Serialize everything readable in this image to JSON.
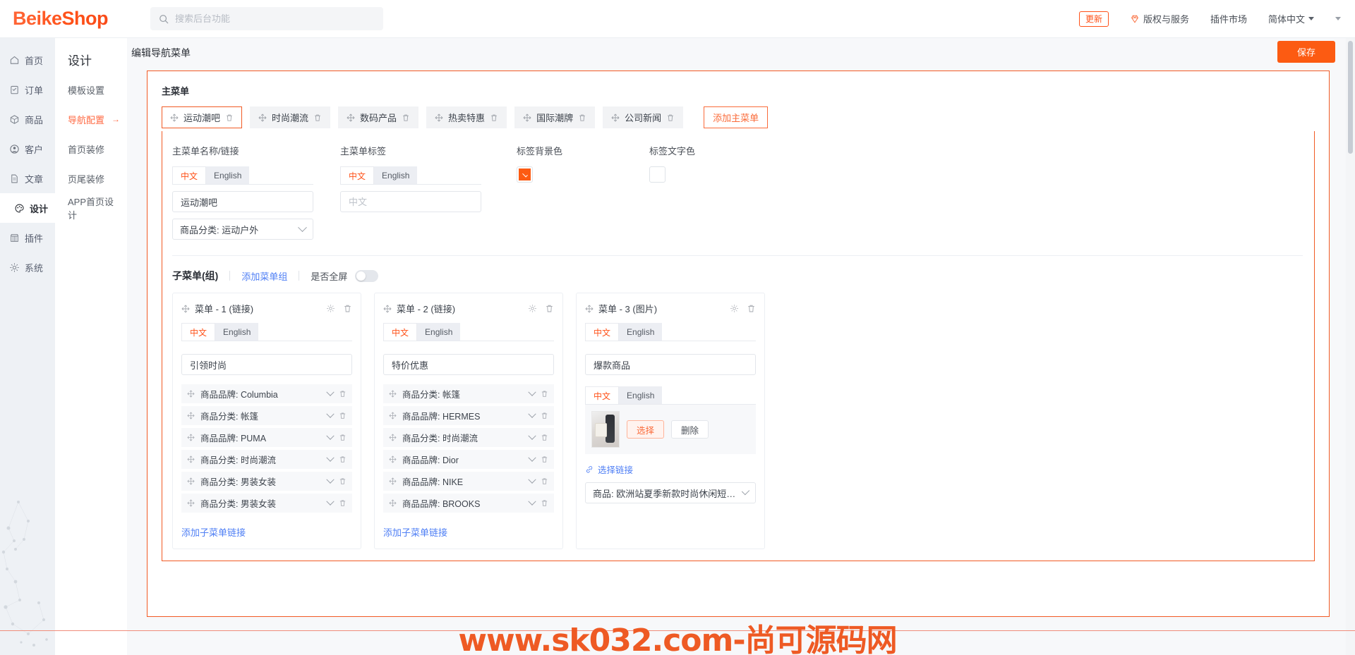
{
  "header": {
    "logo": "BeikeShop",
    "search_placeholder": "搜索后台功能",
    "search_value": "",
    "update_badge": "更新",
    "copyright": "版权与服务",
    "plugin_market": "插件市场",
    "language": "简体中文",
    "accent_color": "#ff5118"
  },
  "rail": {
    "items": [
      {
        "label": "首页",
        "icon": "home-icon"
      },
      {
        "label": "订单",
        "icon": "clipboard-icon"
      },
      {
        "label": "商品",
        "icon": "box-icon"
      },
      {
        "label": "客户",
        "icon": "user-icon"
      },
      {
        "label": "文章",
        "icon": "file-icon"
      },
      {
        "label": "设计",
        "icon": "palette-icon",
        "active": true
      },
      {
        "label": "插件",
        "icon": "shop-icon"
      },
      {
        "label": "系统",
        "icon": "gear-icon"
      }
    ]
  },
  "submenu": {
    "title": "设计",
    "items": [
      {
        "label": "模板设置"
      },
      {
        "label": "导航配置",
        "active": true,
        "arrow": "→"
      },
      {
        "label": "首页装修"
      },
      {
        "label": "页尾装修"
      },
      {
        "label": "APP首页设计"
      }
    ]
  },
  "page": {
    "title": "编辑导航菜单",
    "save_label": "保存"
  },
  "main_menu": {
    "section_label": "主菜单",
    "tabs": [
      {
        "label": "运动潮吧",
        "active": true
      },
      {
        "label": "时尚潮流",
        "active": false
      },
      {
        "label": "数码产品",
        "active": false
      },
      {
        "label": "热卖特惠",
        "active": false
      },
      {
        "label": "国际潮牌",
        "active": false
      },
      {
        "label": "公司新闻",
        "active": false
      }
    ],
    "add_button": "添加主菜单"
  },
  "form": {
    "name_link_label": "主菜单名称/链接",
    "tag_label": "主菜单标签",
    "tag_bg_label": "标签背景色",
    "tag_text_label": "标签文字色",
    "lang_cn": "中文",
    "lang_en": "English",
    "name_value": "运动潮吧",
    "tag_value": "",
    "tag_placeholder": "中文",
    "link_select": "商品分类: 运动户外",
    "tag_bg_color": "#fc5b12",
    "tag_text_color": "#ffffff"
  },
  "submenu_section": {
    "title": "子菜单(组)",
    "add_group": "添加菜单组",
    "fullscreen_label": "是否全屏",
    "fullscreen_on": false
  },
  "cards": [
    {
      "title": "菜单 - 1 (链接)",
      "lang_cn": "中文",
      "lang_en": "English",
      "name": "引领时尚",
      "items": [
        "商品品牌: Columbia",
        "商品分类: 帐篷",
        "商品品牌: PUMA",
        "商品分类: 时尚潮流",
        "商品分类: 男装女装",
        "商品分类: 男装女装"
      ],
      "add_link": "添加子菜单链接"
    },
    {
      "title": "菜单 - 2 (链接)",
      "lang_cn": "中文",
      "lang_en": "English",
      "name": "特价优惠",
      "items": [
        "商品分类: 帐篷",
        "商品品牌: HERMES",
        "商品分类: 时尚潮流",
        "商品品牌: Dior",
        "商品品牌: NIKE",
        "商品品牌: BROOKS"
      ],
      "add_link": "添加子菜单链接"
    },
    {
      "title": "菜单 - 3 (图片)",
      "lang_cn": "中文",
      "lang_en": "English",
      "name": "爆款商品",
      "img_lang_cn": "中文",
      "img_lang_en": "English",
      "choose_button": "选择",
      "delete_button": "删除",
      "pick_link": "选择链接",
      "product_select": "商品: 欧洲站夏季新款时尚休闲短裤热裤女裤运..."
    }
  ],
  "watermark": "www.sk032.com-尚可源码网"
}
